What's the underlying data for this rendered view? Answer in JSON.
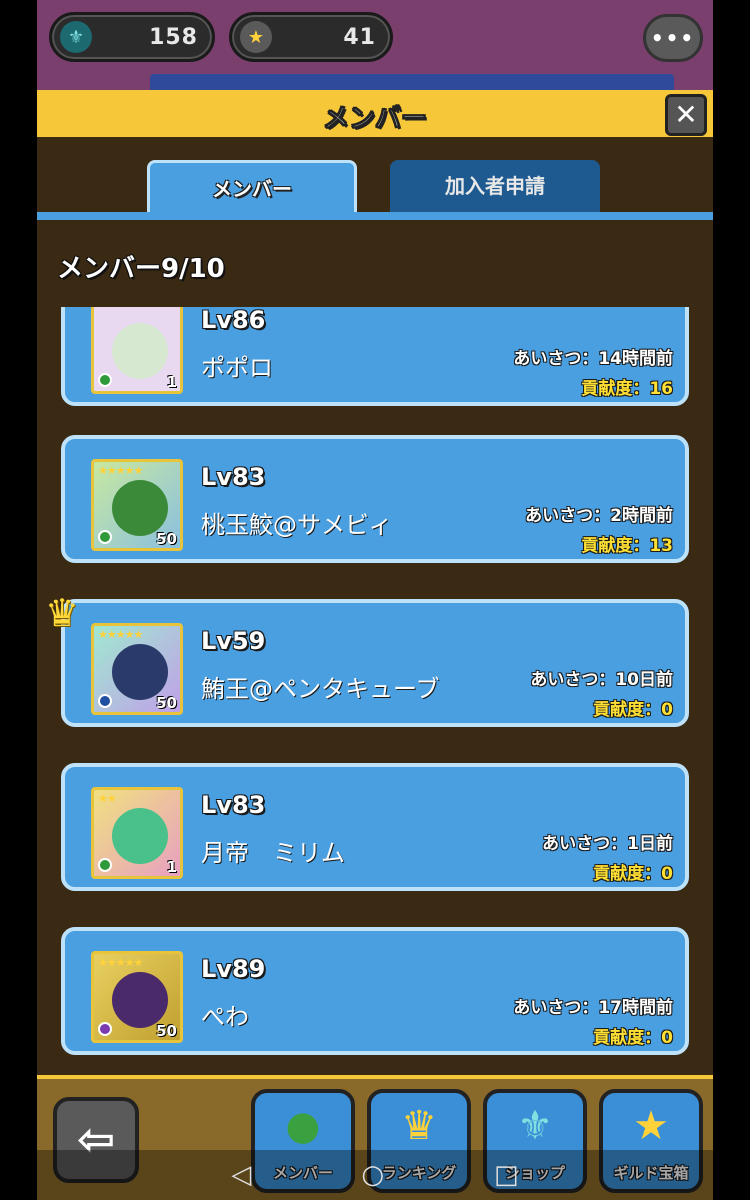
{
  "topbar": {
    "currency_a": "158",
    "currency_b": "41",
    "chat_icon": "chat-bubble-icon"
  },
  "modal": {
    "title": "メンバー",
    "close_label": "✕",
    "tabs": [
      {
        "label": "メンバー",
        "active": true
      },
      {
        "label": "加入者申請",
        "active": false
      }
    ],
    "member_count_label": "メンバー9/10"
  },
  "members": [
    {
      "level": "Lv86",
      "name": "ポポロ",
      "greeting": "あいさつ：14時間前",
      "contribution": "貢献度：16",
      "badge": "1",
      "art_color": "#d7e8d0",
      "orb_color": "#2f9a3a"
    },
    {
      "level": "Lv83",
      "name": "桃玉鮫@サメビィ",
      "greeting": "あいさつ：2時間前",
      "contribution": "貢献度：13",
      "badge": "50",
      "art_color": "#3b8a3a",
      "orb_color": "#2f9a3a"
    },
    {
      "level": "Lv59",
      "name": "鮪王@ペンタキューブ",
      "greeting": "あいさつ：10日前",
      "contribution": "貢献度：0",
      "badge": "50",
      "art_color": "#2a3a6a",
      "orb_color": "#1f4fa0"
    },
    {
      "level": "Lv83",
      "name": "月帝　ミリム",
      "greeting": "あいさつ：1日前",
      "contribution": "貢献度：0",
      "badge": "1",
      "art_color": "#4ac08a",
      "orb_color": "#2f9a3a"
    },
    {
      "level": "Lv89",
      "name": "ぺわ",
      "greeting": "あいさつ：17時間前",
      "contribution": "貢献度：0",
      "badge": "50",
      "art_color": "#4a2a6a",
      "orb_color": "#7a3ab0"
    }
  ],
  "bottom_nav": {
    "back_icon": "back-arrow-icon",
    "items": [
      {
        "label": "メンバー",
        "icon": "members-icon"
      },
      {
        "label": "ランキング",
        "icon": "crown-icon"
      },
      {
        "label": "ショップ",
        "icon": "fleur-coin-icon"
      },
      {
        "label": "ギルド宝箱",
        "icon": "medal-star-icon"
      }
    ]
  },
  "colors": {
    "header_yellow": "#f7c73a",
    "card_blue": "#4a9fe0",
    "panel_brown": "#3b2a13",
    "contribution_yellow": "#ffe033"
  }
}
